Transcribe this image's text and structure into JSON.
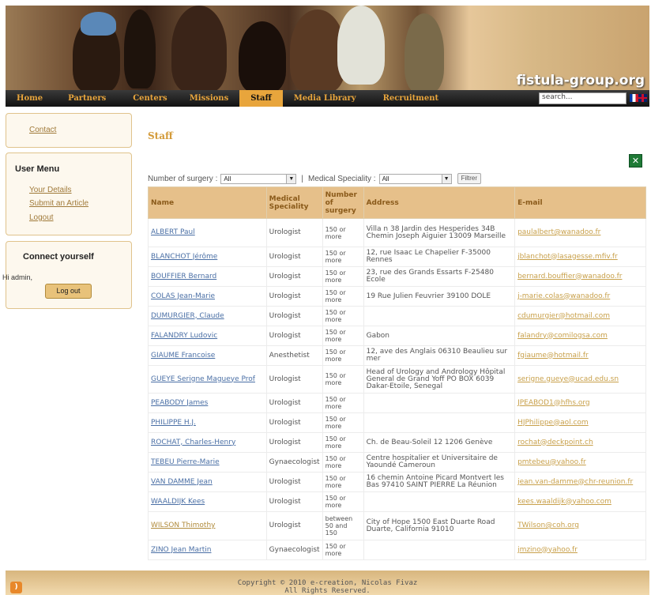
{
  "header": {
    "site_title": "fistula-group.org"
  },
  "nav": {
    "items": [
      "Home",
      "Partners",
      "Centers",
      "Missions",
      "Staff",
      "Media Library",
      "Recruitment"
    ],
    "active": "Staff",
    "search_value": "search..."
  },
  "sidebar": {
    "contact": "Contact",
    "user_menu_title": "User Menu",
    "user_menu": [
      "Your Details",
      "Submit an Article",
      "Logout"
    ],
    "connect_title": "Connect yourself",
    "greeting": "Hi admin,",
    "logout_button": "Log out"
  },
  "main": {
    "title": "Staff",
    "filter_surgery_label": "Number of surgery :",
    "filter_surgery_value": "All",
    "separator": "|",
    "filter_speciality_label": "Medical Speciality :",
    "filter_speciality_value": "All",
    "filter_button": "Filtrer",
    "columns": [
      "Name",
      "Medical Speciality",
      "Number of surgery",
      "Address",
      "E-mail"
    ],
    "rows": [
      {
        "name": "ALBERT Paul",
        "spec": "Urologist",
        "num": "150 or more",
        "addr": "Villa n 38 Jardin des Hesperides 34B Chemin Joseph Aiguier 13009 Marseille",
        "email": "paulalbert@wanadoo.fr"
      },
      {
        "name": "BLANCHOT Jérôme",
        "spec": "Urologist",
        "num": "150 or more",
        "addr": "12, rue Isaac Le Chapelier F-35000 Rennes",
        "email": "jblanchot@lasagesse.mfiv.fr"
      },
      {
        "name": "BOUFFIER Bernard",
        "spec": "Urologist",
        "num": "150 or more",
        "addr": "23, rue des Grands Essarts F-25480 Ecole",
        "email": "bernard.bouffier@wanadoo.fr"
      },
      {
        "name": "COLAS Jean-Marie",
        "spec": "Urologist",
        "num": "150 or more",
        "addr": "19 Rue Julien Feuvrier 39100 DOLE",
        "email": "j-marie.colas@wanadoo.fr"
      },
      {
        "name": "DUMURGIER, Claude",
        "spec": "Urologist",
        "num": "150 or more",
        "addr": "",
        "email": "cdumurgier@hotmail.com"
      },
      {
        "name": "FALANDRY Ludovic",
        "spec": "Urologist",
        "num": "150 or more",
        "addr": "Gabon",
        "email": "falandry@comilogsa.com"
      },
      {
        "name": "GIAUME Francoise",
        "spec": "Anesthetist",
        "num": "150 or more",
        "addr": "12, ave des Anglais 06310 Beaulieu sur mer",
        "email": "fgiaume@hotmail.fr"
      },
      {
        "name": "GUEYE Serigne Magueye Prof",
        "spec": "Urologist",
        "num": "150 or more",
        "addr": "Head of Urology and Andrology Hôpital General de Grand Yoff PO BOX 6039 Dakar-Etoile, Senegal",
        "email": "serigne.gueye@ucad.edu.sn"
      },
      {
        "name": "PEABODY James",
        "spec": "Urologist",
        "num": "150 or more",
        "addr": "",
        "email": "JPEABOD1@hfhs.org"
      },
      {
        "name": "PHILIPPE H.J.",
        "spec": "Urologist",
        "num": "150 or more",
        "addr": "",
        "email": "HJPhilippe@aol.com"
      },
      {
        "name": "ROCHAT, Charles-Henry",
        "spec": "Urologist",
        "num": "150 or more",
        "addr": "Ch. de Beau-Soleil 12 1206 Genève",
        "email": "rochat@deckpoint.ch"
      },
      {
        "name": "TEBEU Pierre-Marie",
        "spec": "Gynaecologist",
        "num": "150 or more",
        "addr": "Centre hospitalier et Universitaire de Yaoundé Cameroun",
        "email": "pmtebeu@yahoo.fr"
      },
      {
        "name": "VAN DAMME Jean",
        "spec": "Urologist",
        "num": "150 or more",
        "addr": "16 chemin Antoine Picard Montvert les Bas 97410 SAINT PIERRE La Réunion",
        "email": "jean.van-damme@chr-reunion.fr"
      },
      {
        "name": "WAALDIJK Kees",
        "spec": "Urologist",
        "num": "150 or more",
        "addr": "",
        "email": "kees.waaldijk@yahoo.com"
      },
      {
        "name": "WILSON Thimothy",
        "spec": "Urologist",
        "num": "between 50 and 150",
        "addr": "City of Hope 1500 East Duarte Road Duarte, California 91010",
        "email": "TWilson@coh.org"
      },
      {
        "name": "ZINO Jean Martin",
        "spec": "Gynaecologist",
        "num": "150 or more",
        "addr": "",
        "email": "jmzino@yahoo.fr"
      }
    ]
  },
  "footer": {
    "line1": "Copyright © 2010 e-creation, Nicolas Fivaz",
    "line2": "All Rights Reserved."
  }
}
